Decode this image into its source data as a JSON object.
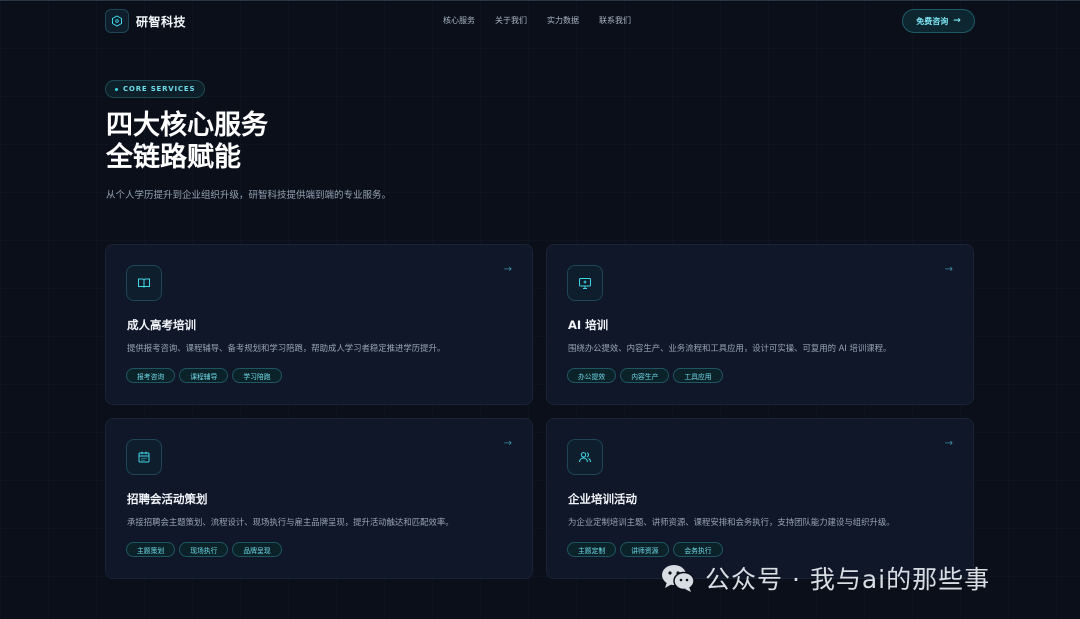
{
  "header": {
    "logo_text": "研智科技",
    "nav": [
      "核心服务",
      "关于我们",
      "实力数据",
      "联系我们"
    ],
    "cta_label": "免费咨询",
    "cta_arrow": "→"
  },
  "hero": {
    "badge": "CORE SERVICES",
    "title_line1": "四大核心服务",
    "title_line2": "全链路赋能",
    "subtitle": "从个人学历提升到企业组织升级，研智科技提供端到端的专业服务。"
  },
  "cards": [
    {
      "icon": "book-icon",
      "title": "成人高考培训",
      "desc": "提供报考咨询、课程辅导、备考规划和学习陪跑，帮助成人学习者稳定推进学历提升。",
      "tags": [
        "报考咨询",
        "课程辅导",
        "学习陪跑"
      ],
      "arrow": "→"
    },
    {
      "icon": "monitor-icon",
      "title": "AI 培训",
      "desc": "围绕办公提效、内容生产、业务流程和工具应用，设计可实操、可复用的 AI 培训课程。",
      "tags": [
        "办公提效",
        "内容生产",
        "工具应用"
      ],
      "arrow": "→"
    },
    {
      "icon": "calendar-icon",
      "title": "招聘会活动策划",
      "desc": "承接招聘会主题策划、流程设计、现场执行与雇主品牌呈现，提升活动触达和匹配效率。",
      "tags": [
        "主题策划",
        "现场执行",
        "品牌呈现"
      ],
      "arrow": "→"
    },
    {
      "icon": "users-icon",
      "title": "企业培训活动",
      "desc": "为企业定制培训主题、讲师资源、课程安排和会务执行，支持团队能力建设与组织升级。",
      "tags": [
        "主题定制",
        "讲师资源",
        "会务执行"
      ],
      "arrow": "→"
    }
  ],
  "watermark": {
    "text": "公众号 · 我与ai的那些事",
    "icon": "wechat-icon"
  },
  "colors": {
    "background": "#0a0f1a",
    "card": "#0f1728",
    "accent": "#3fd6e8"
  }
}
